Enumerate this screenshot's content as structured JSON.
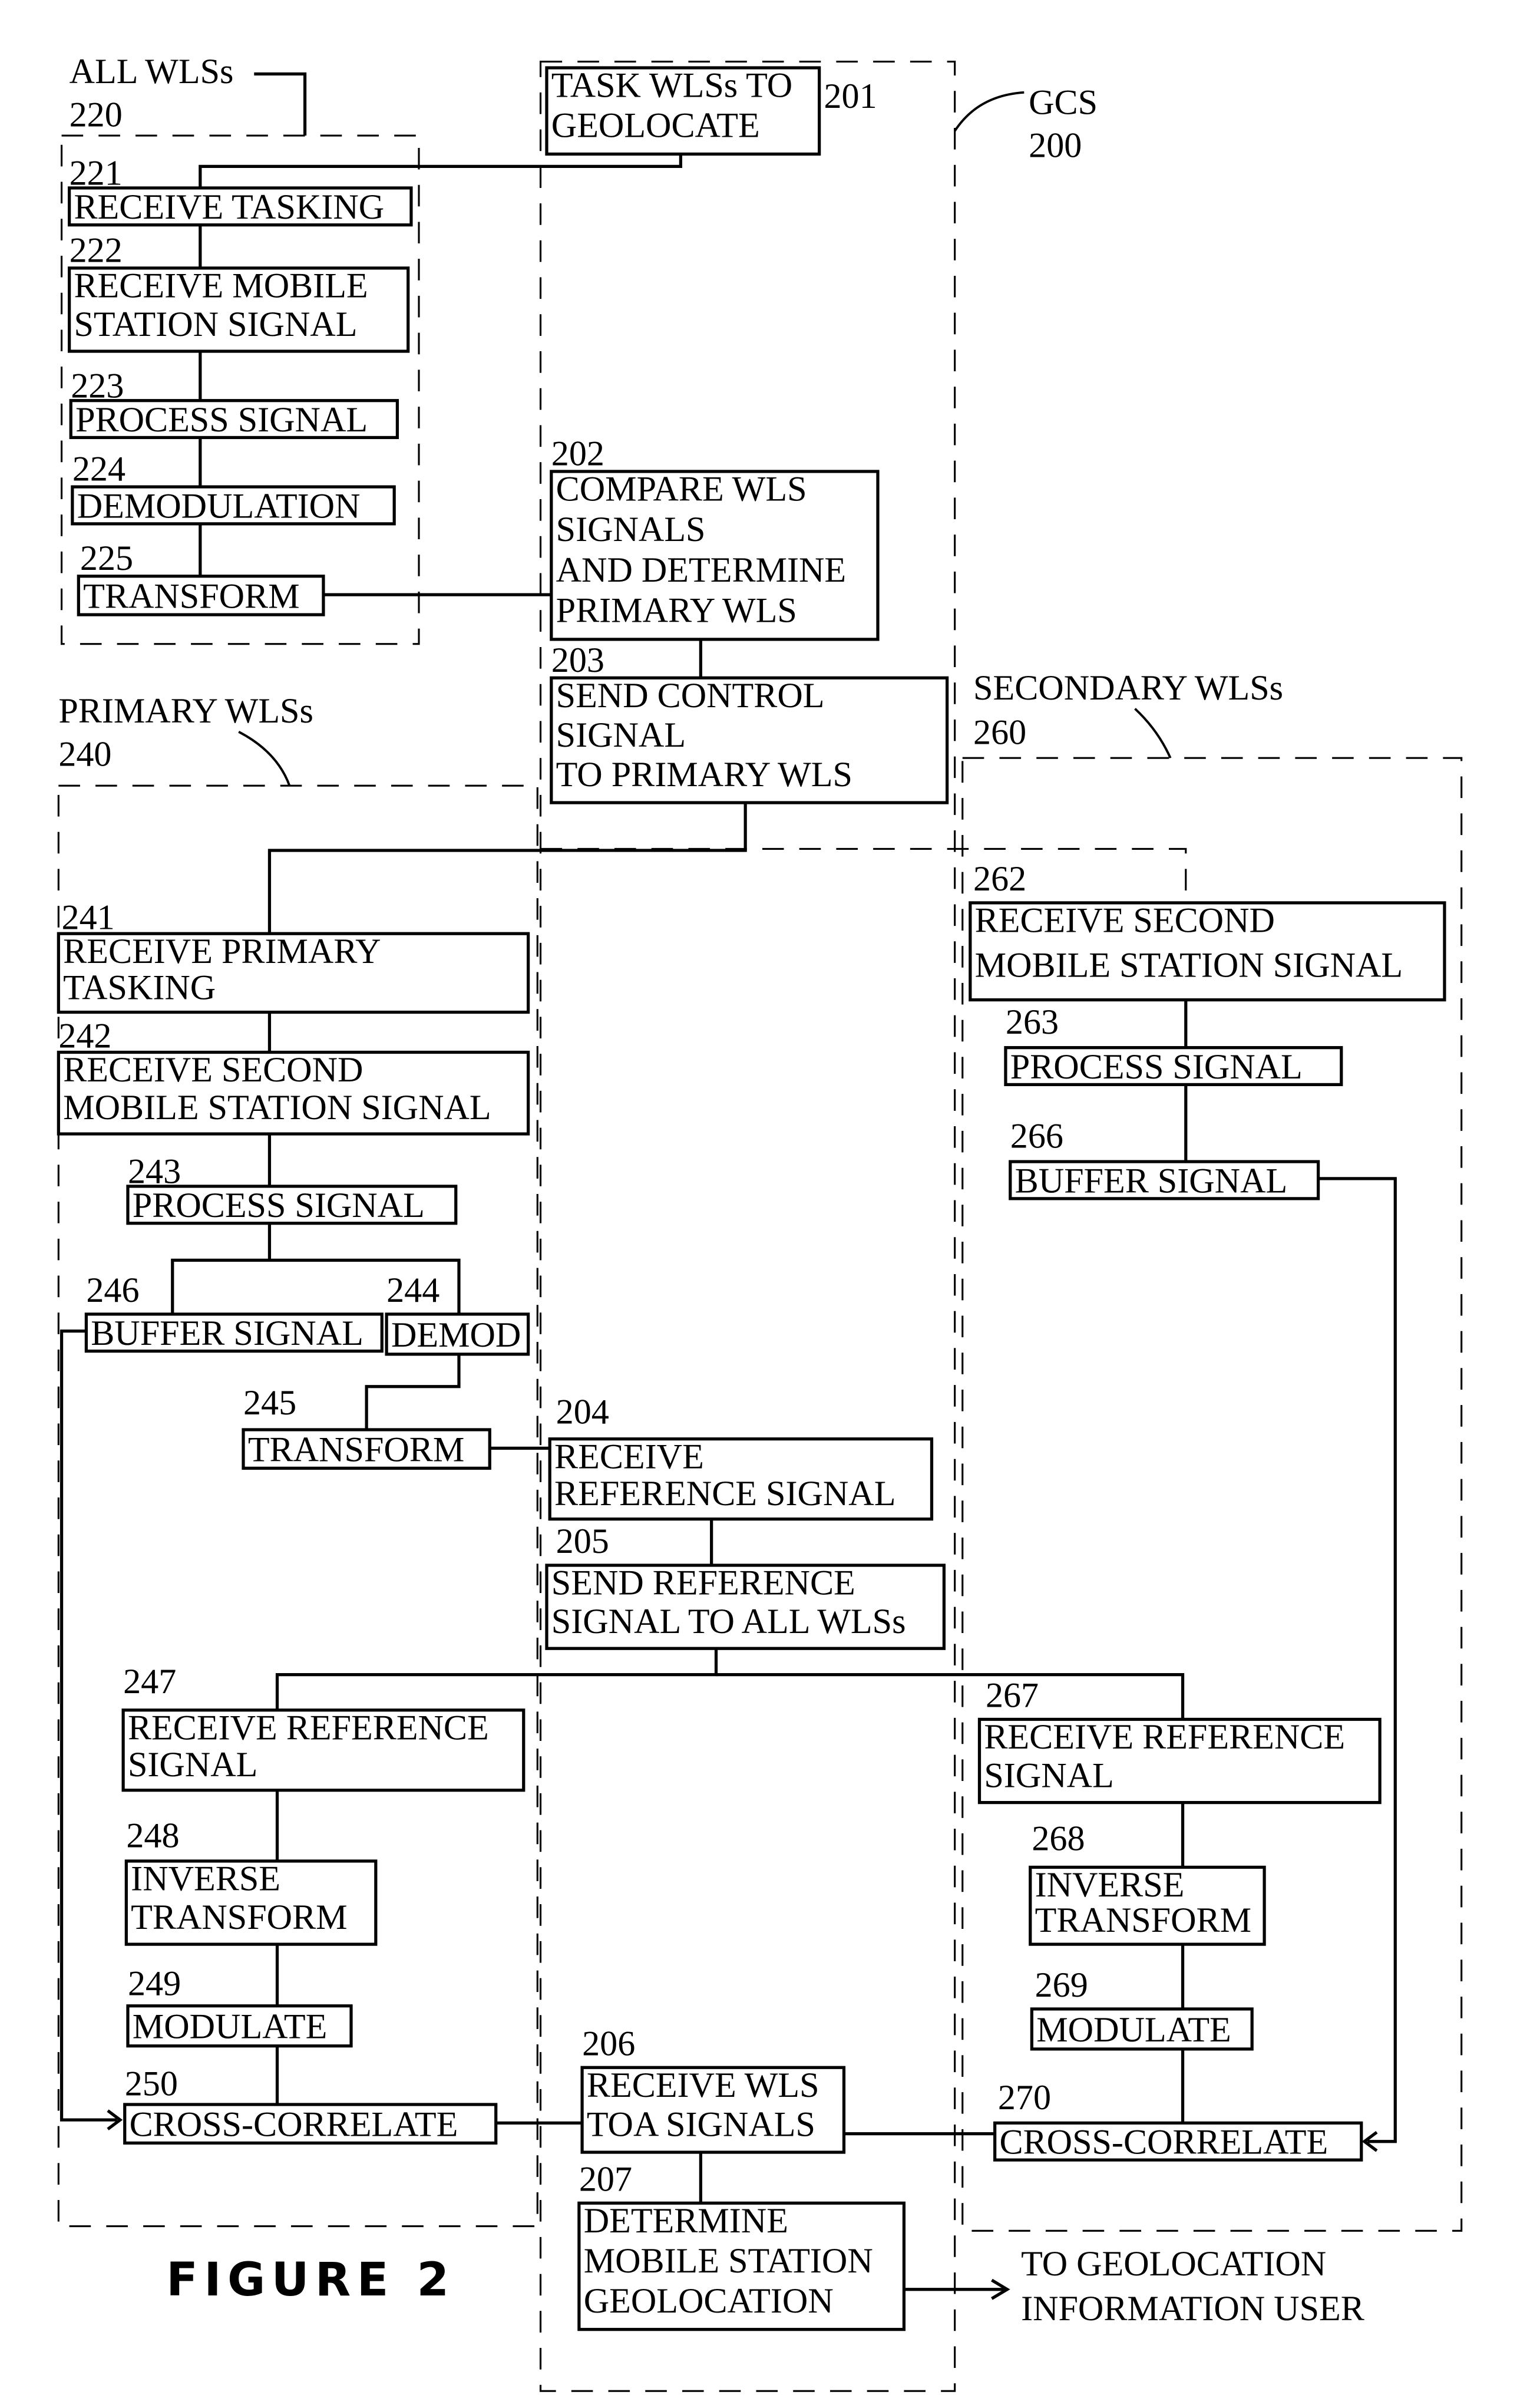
{
  "figure_title": "FIGURE 2",
  "groups": {
    "all_wls": {
      "label": "ALL WLSs",
      "ref": "220"
    },
    "gcs": {
      "label": "GCS",
      "ref": "200"
    },
    "primary_wls": {
      "label": "PRIMARY WLSs",
      "ref": "240"
    },
    "secondary_wls": {
      "label": "SECONDARY WLSs",
      "ref": "260"
    }
  },
  "steps": {
    "s201": {
      "ref": "201",
      "lines": [
        "TASK WLSs TO",
        "GEOLOCATE"
      ]
    },
    "s202": {
      "ref": "202",
      "lines": [
        "COMPARE WLS",
        "SIGNALS",
        "AND DETERMINE",
        "PRIMARY WLS"
      ]
    },
    "s203": {
      "ref": "203",
      "lines": [
        "SEND CONTROL",
        "SIGNAL",
        "TO PRIMARY WLS"
      ]
    },
    "s204": {
      "ref": "204",
      "lines": [
        "RECEIVE",
        "REFERENCE SIGNAL"
      ]
    },
    "s205": {
      "ref": "205",
      "lines": [
        "SEND REFERENCE",
        "SIGNAL TO ALL WLSs"
      ]
    },
    "s206": {
      "ref": "206",
      "lines": [
        "RECEIVE WLS",
        "TOA SIGNALS"
      ]
    },
    "s207": {
      "ref": "207",
      "lines": [
        "DETERMINE",
        "MOBILE STATION",
        "GEOLOCATION"
      ]
    },
    "s221": {
      "ref": "221",
      "lines": [
        "RECEIVE TASKING"
      ]
    },
    "s222": {
      "ref": "222",
      "lines": [
        "RECEIVE MOBILE",
        "STATION SIGNAL"
      ]
    },
    "s223": {
      "ref": "223",
      "lines": [
        "PROCESS SIGNAL"
      ]
    },
    "s224": {
      "ref": "224",
      "lines": [
        "DEMODULATION"
      ]
    },
    "s225": {
      "ref": "225",
      "lines": [
        "TRANSFORM"
      ]
    },
    "s241": {
      "ref": "241",
      "lines": [
        "RECEIVE PRIMARY",
        " TASKING"
      ]
    },
    "s242": {
      "ref": "242",
      "lines": [
        "RECEIVE SECOND",
        "MOBILE STATION SIGNAL"
      ]
    },
    "s243": {
      "ref": "243",
      "lines": [
        "PROCESS SIGNAL"
      ]
    },
    "s244": {
      "ref": "244",
      "lines": [
        "DEMOD"
      ]
    },
    "s245": {
      "ref": "245",
      "lines": [
        "TRANSFORM"
      ]
    },
    "s246": {
      "ref": "246",
      "lines": [
        "BUFFER SIGNAL"
      ]
    },
    "s247": {
      "ref": "247",
      "lines": [
        "RECEIVE REFERENCE",
        "SIGNAL"
      ]
    },
    "s248": {
      "ref": "248",
      "lines": [
        "INVERSE",
        "TRANSFORM"
      ]
    },
    "s249": {
      "ref": "249",
      "lines": [
        "MODULATE"
      ]
    },
    "s250": {
      "ref": "250",
      "lines": [
        "CROSS-CORRELATE"
      ]
    },
    "s262": {
      "ref": "262",
      "lines": [
        "RECEIVE SECOND",
        "MOBILE STATION SIGNAL"
      ]
    },
    "s263": {
      "ref": "263",
      "lines": [
        "PROCESS SIGNAL"
      ]
    },
    "s266": {
      "ref": "266",
      "lines": [
        "BUFFER SIGNAL"
      ]
    },
    "s267": {
      "ref": "267",
      "lines": [
        "RECEIVE REFERENCE",
        "SIGNAL"
      ]
    },
    "s268": {
      "ref": "268",
      "lines": [
        "INVERSE",
        "TRANSFORM"
      ]
    },
    "s269": {
      "ref": "269",
      "lines": [
        "MODULATE"
      ]
    },
    "s270": {
      "ref": "270",
      "lines": [
        "CROSS-CORRELATE"
      ]
    }
  },
  "output": {
    "lines": [
      "TO GEOLOCATION",
      "INFORMATION USER"
    ]
  }
}
